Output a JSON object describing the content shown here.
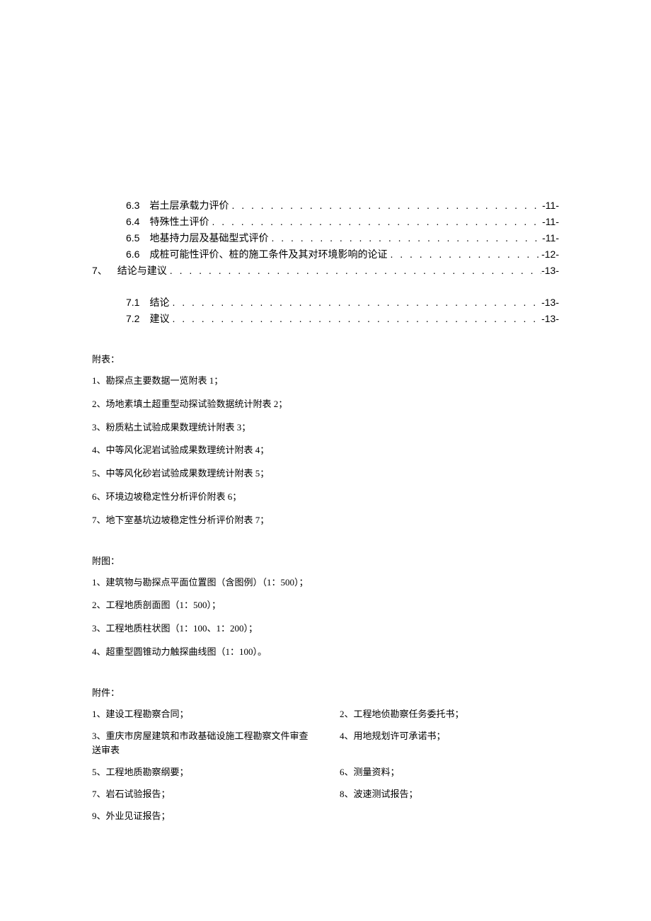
{
  "toc": {
    "items": [
      {
        "indent": "sub",
        "num": "6.3",
        "title": "岩土层承载力评价",
        "page": "-11-"
      },
      {
        "indent": "sub",
        "num": "6.4",
        "title": "特殊性土评价",
        "page": "-11-"
      },
      {
        "indent": "sub",
        "num": "6.5",
        "title": "地基持力层及基础型式评价",
        "page": "-11-"
      },
      {
        "indent": "sub",
        "num": "6.6",
        "title": "成桩可能性评价、桩的施工条件及其对环境影响的论证",
        "page": "-12-"
      },
      {
        "indent": "main",
        "num": "7、",
        "title": "结论与建议",
        "page": "-13-"
      }
    ],
    "items2": [
      {
        "indent": "sub",
        "num": "7.1",
        "title": "结论",
        "page": "-13-"
      },
      {
        "indent": "sub",
        "num": "7.2",
        "title": "建议",
        "page": "-13-"
      }
    ]
  },
  "sections": {
    "tables": {
      "heading": "附表：",
      "items": [
        "1、勘探点主要数据一览附表 1；",
        "2、场地素填土超重型动探试验数据统计附表 2；",
        "3、粉质粘土试验成果数理统计附表 3；",
        "4、中等风化泥岩试验成果数理统计附表 4；",
        "5、中等风化砂岩试验成果数理统计附表 5；",
        "6、环境边坡稳定性分析评价附表 6；",
        "7、地下室基坑边坡稳定性分析评价附表 7；"
      ]
    },
    "figures": {
      "heading": "附图：",
      "items": [
        "1、建筑物与勘探点平面位置图（含图例）（1：500）；",
        "2、工程地质剖面图（1：500）；",
        "3、工程地质柱状图（1：100、1：200）；",
        "4、超重型圆锥动力触探曲线图（1：100）。"
      ]
    },
    "attachments": {
      "heading": "附件：",
      "items": [
        "1、建设工程勘察合同；",
        "2、工程地侦勘察任务委托书；",
        "3、重庆市房屋建筑和市政基础设施工程勘察文件审查送审表",
        "4、用地规划许可承诺书；",
        "5、工程地质勘察纲要；",
        "6、测量资料；",
        "7、岩石试验报告；",
        "8、波速测试报告；",
        "9、外业见证报告；"
      ]
    }
  }
}
